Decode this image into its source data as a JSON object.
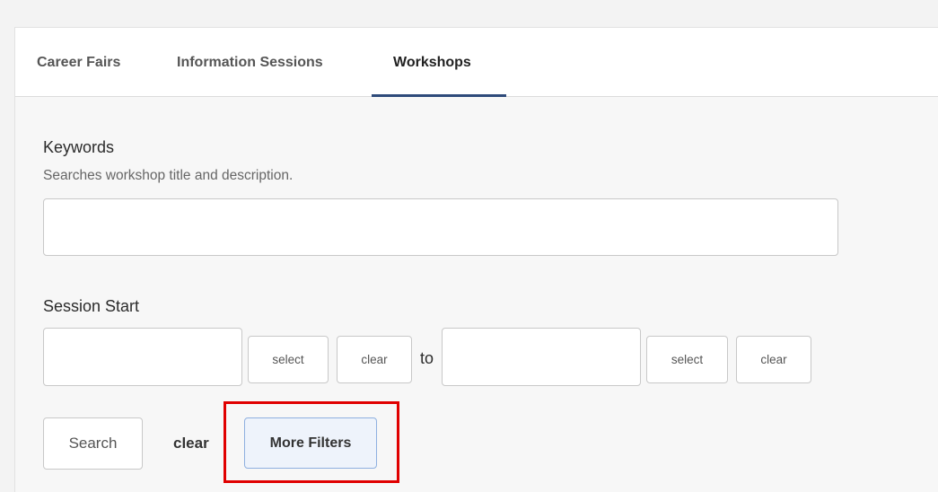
{
  "tabs": [
    {
      "label": "Career Fairs",
      "active": false
    },
    {
      "label": "Information Sessions",
      "active": false
    },
    {
      "label": "Workshops",
      "active": true
    }
  ],
  "keywords": {
    "label": "Keywords",
    "helper": "Searches workshop title and description.",
    "value": "",
    "placeholder": ""
  },
  "session_start": {
    "label": "Session Start",
    "from_value": "",
    "to_value": "",
    "select_label": "select",
    "clear_label": "clear",
    "to_label": "to"
  },
  "actions": {
    "search_label": "Search",
    "clear_label": "clear",
    "more_filters_label": "More Filters"
  },
  "colors": {
    "active_tab_underline": "#2e4a7a",
    "highlight_box": "#e00000",
    "more_filters_border": "#8fb0e0"
  }
}
